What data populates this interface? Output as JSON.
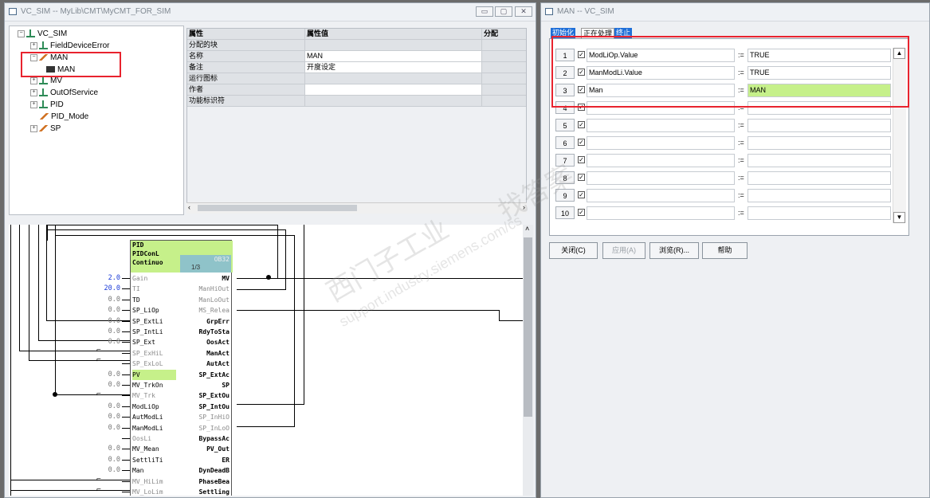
{
  "left_window": {
    "title": "VC_SIM -- MyLib\\CMT\\MyCMT_FOR_SIM",
    "title_buttons": [
      "▭",
      "▢",
      "✕"
    ],
    "tree": [
      {
        "label": "VC_SIM"
      },
      {
        "label": "FieldDeviceError"
      },
      {
        "label": "MAN"
      },
      {
        "label": "MAN"
      },
      {
        "label": "MV"
      },
      {
        "label": "OutOfService"
      },
      {
        "label": "PID"
      },
      {
        "label": "PID_Mode"
      },
      {
        "label": "SP"
      }
    ],
    "property_grid": {
      "headers": [
        "属性",
        "属性值",
        "分配"
      ],
      "rows": [
        {
          "name": "分配的块",
          "value": ""
        },
        {
          "name": "名称",
          "value": "MAN"
        },
        {
          "name": "备注",
          "value": "开度设定"
        },
        {
          "name": "运行图标",
          "value": ""
        },
        {
          "name": "作者",
          "value": ""
        },
        {
          "name": "功能标识符",
          "value": ""
        }
      ]
    },
    "block": {
      "title_lines": [
        "PID",
        "PIDConL",
        "Continuo"
      ],
      "ob": "OB32",
      "cycle": "1/3",
      "inputs": [
        {
          "val": "2.0",
          "pin": "Gain"
        },
        {
          "val": "20.0",
          "pin": "TI"
        },
        {
          "val": "0.0",
          "pin": "TD"
        },
        {
          "val": "0.0",
          "pin": "SP_LiOp"
        },
        {
          "val": "0.0",
          "pin": "SP_ExtLi"
        },
        {
          "val": "0.0",
          "pin": "SP_IntLi"
        },
        {
          "val": "0.0",
          "pin": "SP_Ext"
        },
        {
          "val": "",
          "pin": "SP_ExHiL"
        },
        {
          "val": "",
          "pin": "SP_ExLoL"
        },
        {
          "val": "0.0",
          "pin": "PV"
        },
        {
          "val": "0.0",
          "pin": "MV_TrkOn"
        },
        {
          "val": "",
          "pin": "MV_Trk"
        },
        {
          "val": "0.0",
          "pin": "ModLiOp"
        },
        {
          "val": "0.0",
          "pin": "AutModLi"
        },
        {
          "val": "0.0",
          "pin": "ManModLi"
        },
        {
          "val": "",
          "pin": "OosLi"
        },
        {
          "val": "0.0",
          "pin": "MV_Mean"
        },
        {
          "val": "0.0",
          "pin": "SettliTi"
        },
        {
          "val": "0.0",
          "pin": "Man"
        },
        {
          "val": "",
          "pin": "MV_HiLim"
        },
        {
          "val": "",
          "pin": "MV_LoLim"
        }
      ],
      "outputs": [
        "MV",
        "ManHiOut",
        "ManLoOut",
        "MS_Relea",
        "GrpErr",
        "RdyToSta",
        "OosAct",
        "ManAct",
        "AutAct",
        "SP_ExtAc",
        "SP",
        "SP_ExtOu",
        "SP_IntOu",
        "SP_InHiO",
        "SP_InLoO",
        "BypassAc",
        "PV_Out",
        "ER",
        "DynDeadB",
        "PhaseBea",
        "Settling"
      ]
    }
  },
  "right_window": {
    "title": "MAN -- VC_SIM",
    "tabs": [
      "初始化",
      "正在处理",
      "终止"
    ],
    "assign_op": ":=",
    "rows": [
      {
        "num": "1",
        "left": "ModLiOp.Value",
        "right": "TRUE"
      },
      {
        "num": "2",
        "left": "ManModLi.Value",
        "right": "TRUE"
      },
      {
        "num": "3",
        "left": "Man",
        "right": "MAN"
      },
      {
        "num": "4",
        "left": "",
        "right": ""
      },
      {
        "num": "5",
        "left": "",
        "right": ""
      },
      {
        "num": "6",
        "left": "",
        "right": ""
      },
      {
        "num": "7",
        "left": "",
        "right": ""
      },
      {
        "num": "8",
        "left": "",
        "right": ""
      },
      {
        "num": "9",
        "left": "",
        "right": ""
      },
      {
        "num": "10",
        "left": "",
        "right": ""
      }
    ],
    "buttons": {
      "close": "关闭(C)",
      "apply": "应用(A)",
      "browse": "浏览(R)...",
      "help": "帮助"
    }
  },
  "watermark": {
    "line1": "西门子工业",
    "line2": "support.industry.siemens.com/cs",
    "line3": "找答案"
  },
  "colors": {
    "highlight_green": "#c6f08a",
    "annotation_red": "#e8232e",
    "tab_blue": "#1f6fd8"
  }
}
